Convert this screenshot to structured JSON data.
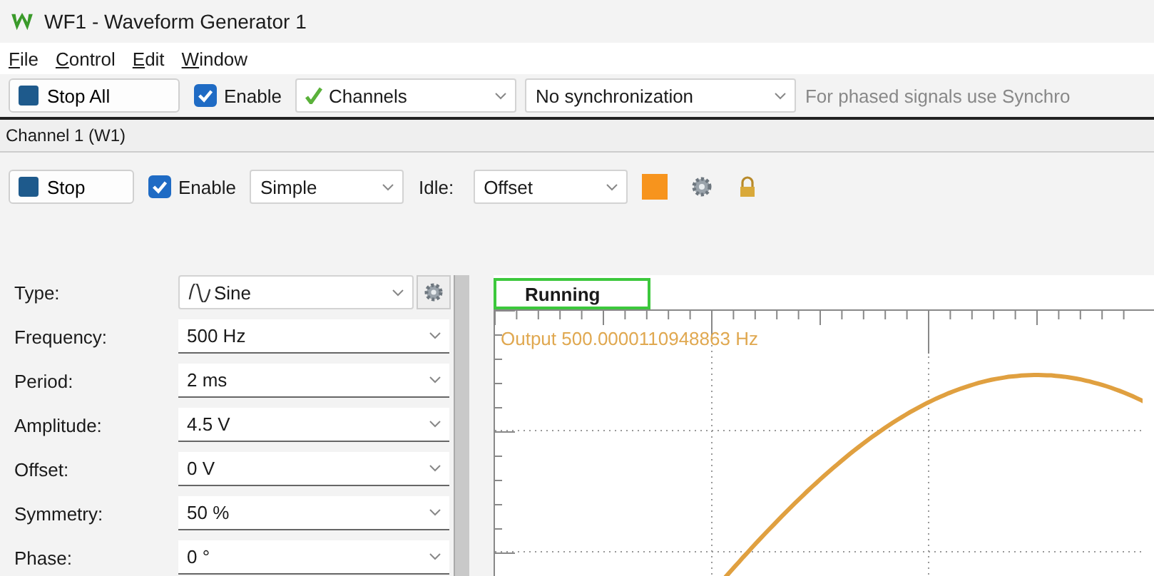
{
  "window": {
    "title": "WF1 - Waveform Generator 1"
  },
  "menu": [
    {
      "accel": "F",
      "rest": "ile"
    },
    {
      "accel": "C",
      "rest": "ontrol"
    },
    {
      "accel": "E",
      "rest": "dit"
    },
    {
      "accel": "W",
      "rest": "indow"
    }
  ],
  "toolbar": {
    "stop_all": "Stop All",
    "enable": {
      "label": "Enable",
      "checked": true
    },
    "channels": "Channels",
    "sync": "No synchronization",
    "hint": "For phased signals use Synchro"
  },
  "channel": {
    "title": "Channel 1 (W1)",
    "toolbar": {
      "stop": "Stop",
      "enable": {
        "label": "Enable",
        "checked": true
      },
      "mode": "Simple",
      "idle_label": "Idle:",
      "idle": "Offset"
    },
    "params": [
      {
        "kind": "type",
        "label": "Type:",
        "value": "Sine"
      },
      {
        "kind": "value",
        "label": "Frequency:",
        "value": "500 Hz"
      },
      {
        "kind": "value",
        "label": "Period:",
        "value": "2 ms"
      },
      {
        "kind": "value",
        "label": "Amplitude:",
        "value": "4.5 V"
      },
      {
        "kind": "value",
        "label": "Offset:",
        "value": "0 V"
      },
      {
        "kind": "value",
        "label": "Symmetry:",
        "value": "50 %"
      },
      {
        "kind": "value",
        "label": "Phase:",
        "value": "0 °"
      }
    ],
    "scope": {
      "status": "Running",
      "readout": "Output 500.0000110948863 Hz"
    }
  }
}
